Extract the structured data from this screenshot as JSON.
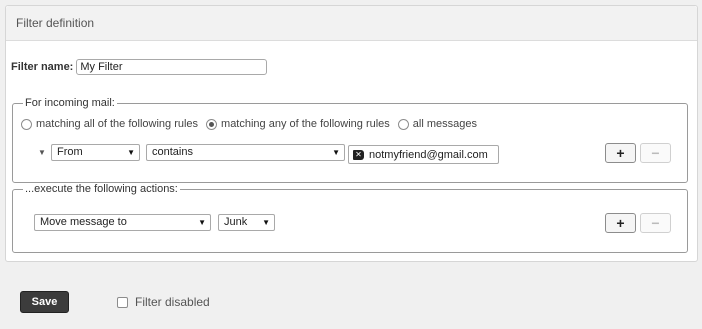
{
  "panel": {
    "title": "Filter definition"
  },
  "filter_name": {
    "label": "Filter name:",
    "value": "My Filter"
  },
  "incoming": {
    "legend": "For incoming mail:",
    "options": [
      {
        "label": "matching all of the following rules",
        "checked": false
      },
      {
        "label": "matching any of the following rules",
        "checked": true
      },
      {
        "label": "all messages",
        "checked": false
      }
    ],
    "rule": {
      "field": "From",
      "operator": "contains",
      "value": "notmyfriend@gmail.com",
      "add_label": "+",
      "remove_label": "−"
    }
  },
  "actions": {
    "legend": "...execute the following actions:",
    "action": "Move message to",
    "folder": "Junk",
    "add_label": "+",
    "remove_label": "−"
  },
  "footer": {
    "save_label": "Save",
    "disabled_label": "Filter disabled"
  }
}
